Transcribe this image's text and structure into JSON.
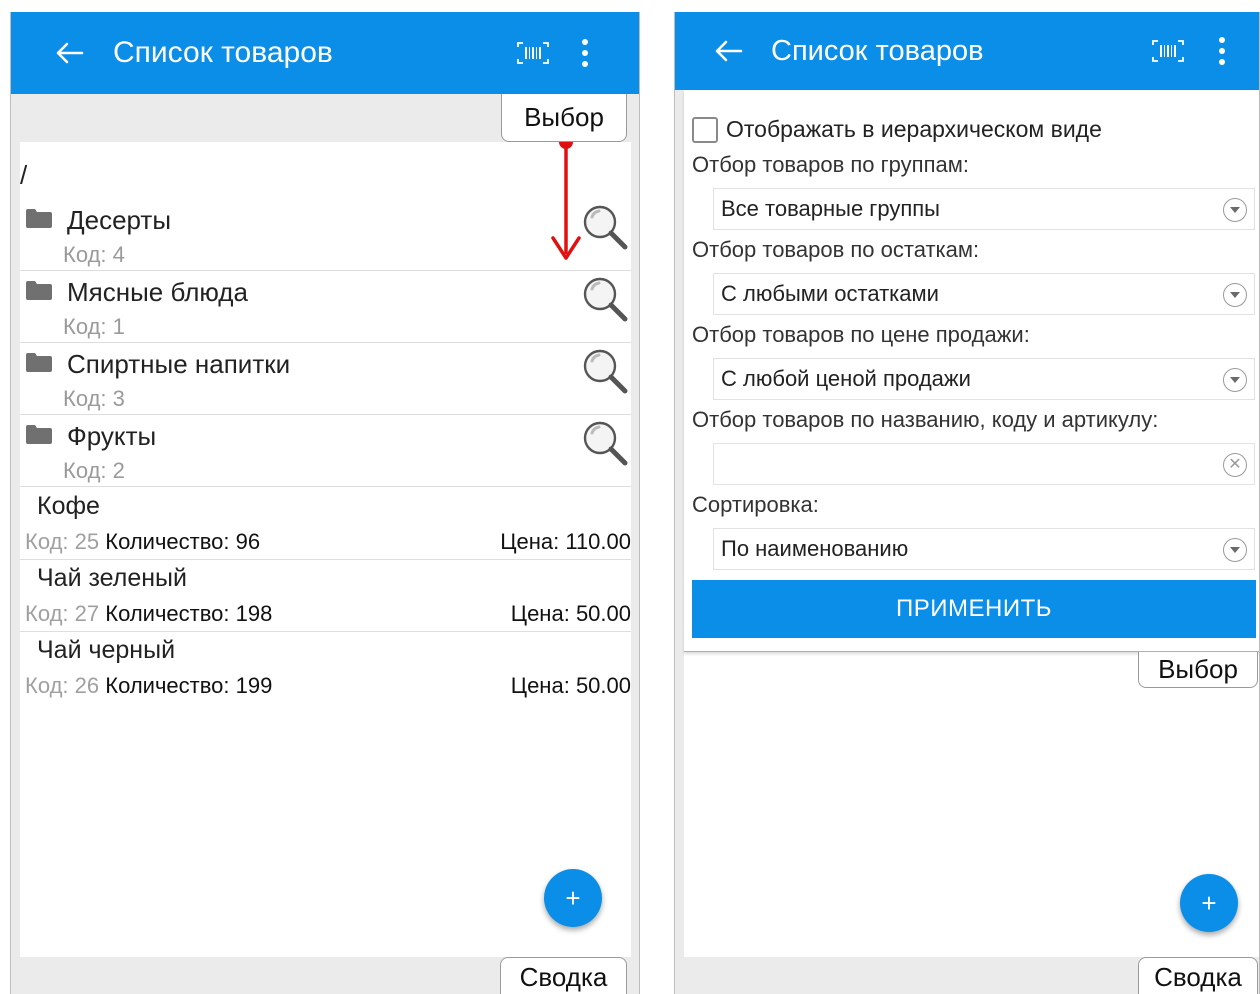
{
  "left_screen": {
    "appbar": {
      "title": "Список товаров"
    },
    "tabs": {
      "select": "Выбор",
      "summary": "Сводка"
    },
    "path": "/",
    "groups": [
      {
        "name": "Десерты",
        "code_label": "Код:",
        "code": "4"
      },
      {
        "name": "Мясные блюда",
        "code_label": "Код:",
        "code": "1"
      },
      {
        "name": "Спиртные напитки",
        "code_label": "Код:",
        "code": "3"
      },
      {
        "name": "Фрукты",
        "code_label": "Код:",
        "code": "2"
      }
    ],
    "items": [
      {
        "name": "Кофе",
        "code_label": "Код:",
        "code": "25",
        "qty_label": "Количество:",
        "qty": "96",
        "price_label": "Цена:",
        "price": "110.00"
      },
      {
        "name": "Чай зеленый",
        "code_label": "Код:",
        "code": "27",
        "qty_label": "Количество:",
        "qty": "198",
        "price_label": "Цена:",
        "price": "50.00"
      },
      {
        "name": "Чай черный",
        "code_label": "Код:",
        "code": "26",
        "qty_label": "Количество:",
        "qty": "199",
        "price_label": "Цена:",
        "price": "50.00"
      }
    ],
    "fab": "+"
  },
  "right_screen": {
    "appbar": {
      "title": "Список товаров"
    },
    "filter": {
      "hierarchy_label": "Отображать в иерархическом виде",
      "hierarchy_checked": false,
      "groups_label": "Отбор товаров по группам:",
      "groups_value": "Все товарные группы",
      "stock_label": "Отбор товаров по остаткам:",
      "stock_value": "С любыми остатками",
      "price_label": "Отбор товаров по цене продажи:",
      "price_value": "С любой ценой продажи",
      "search_label": "Отбор товаров по названию, коду и артикулу:",
      "search_value": "",
      "sort_label": "Сортировка:",
      "sort_value": "По наименованию",
      "apply_label": "ПРИМЕНИТЬ"
    },
    "tabs": {
      "select": "Выбор",
      "summary": "Сводка"
    },
    "fab": "+"
  },
  "colors": {
    "accent": "#0b8ee8",
    "arrow": "#e01010",
    "background": "#ebebeb"
  },
  "icons": [
    "back-arrow-icon",
    "barcode-icon",
    "more-vert-icon",
    "folder-icon",
    "magnifier-icon",
    "dropdown-caret-icon",
    "clear-icon",
    "plus-icon"
  ]
}
